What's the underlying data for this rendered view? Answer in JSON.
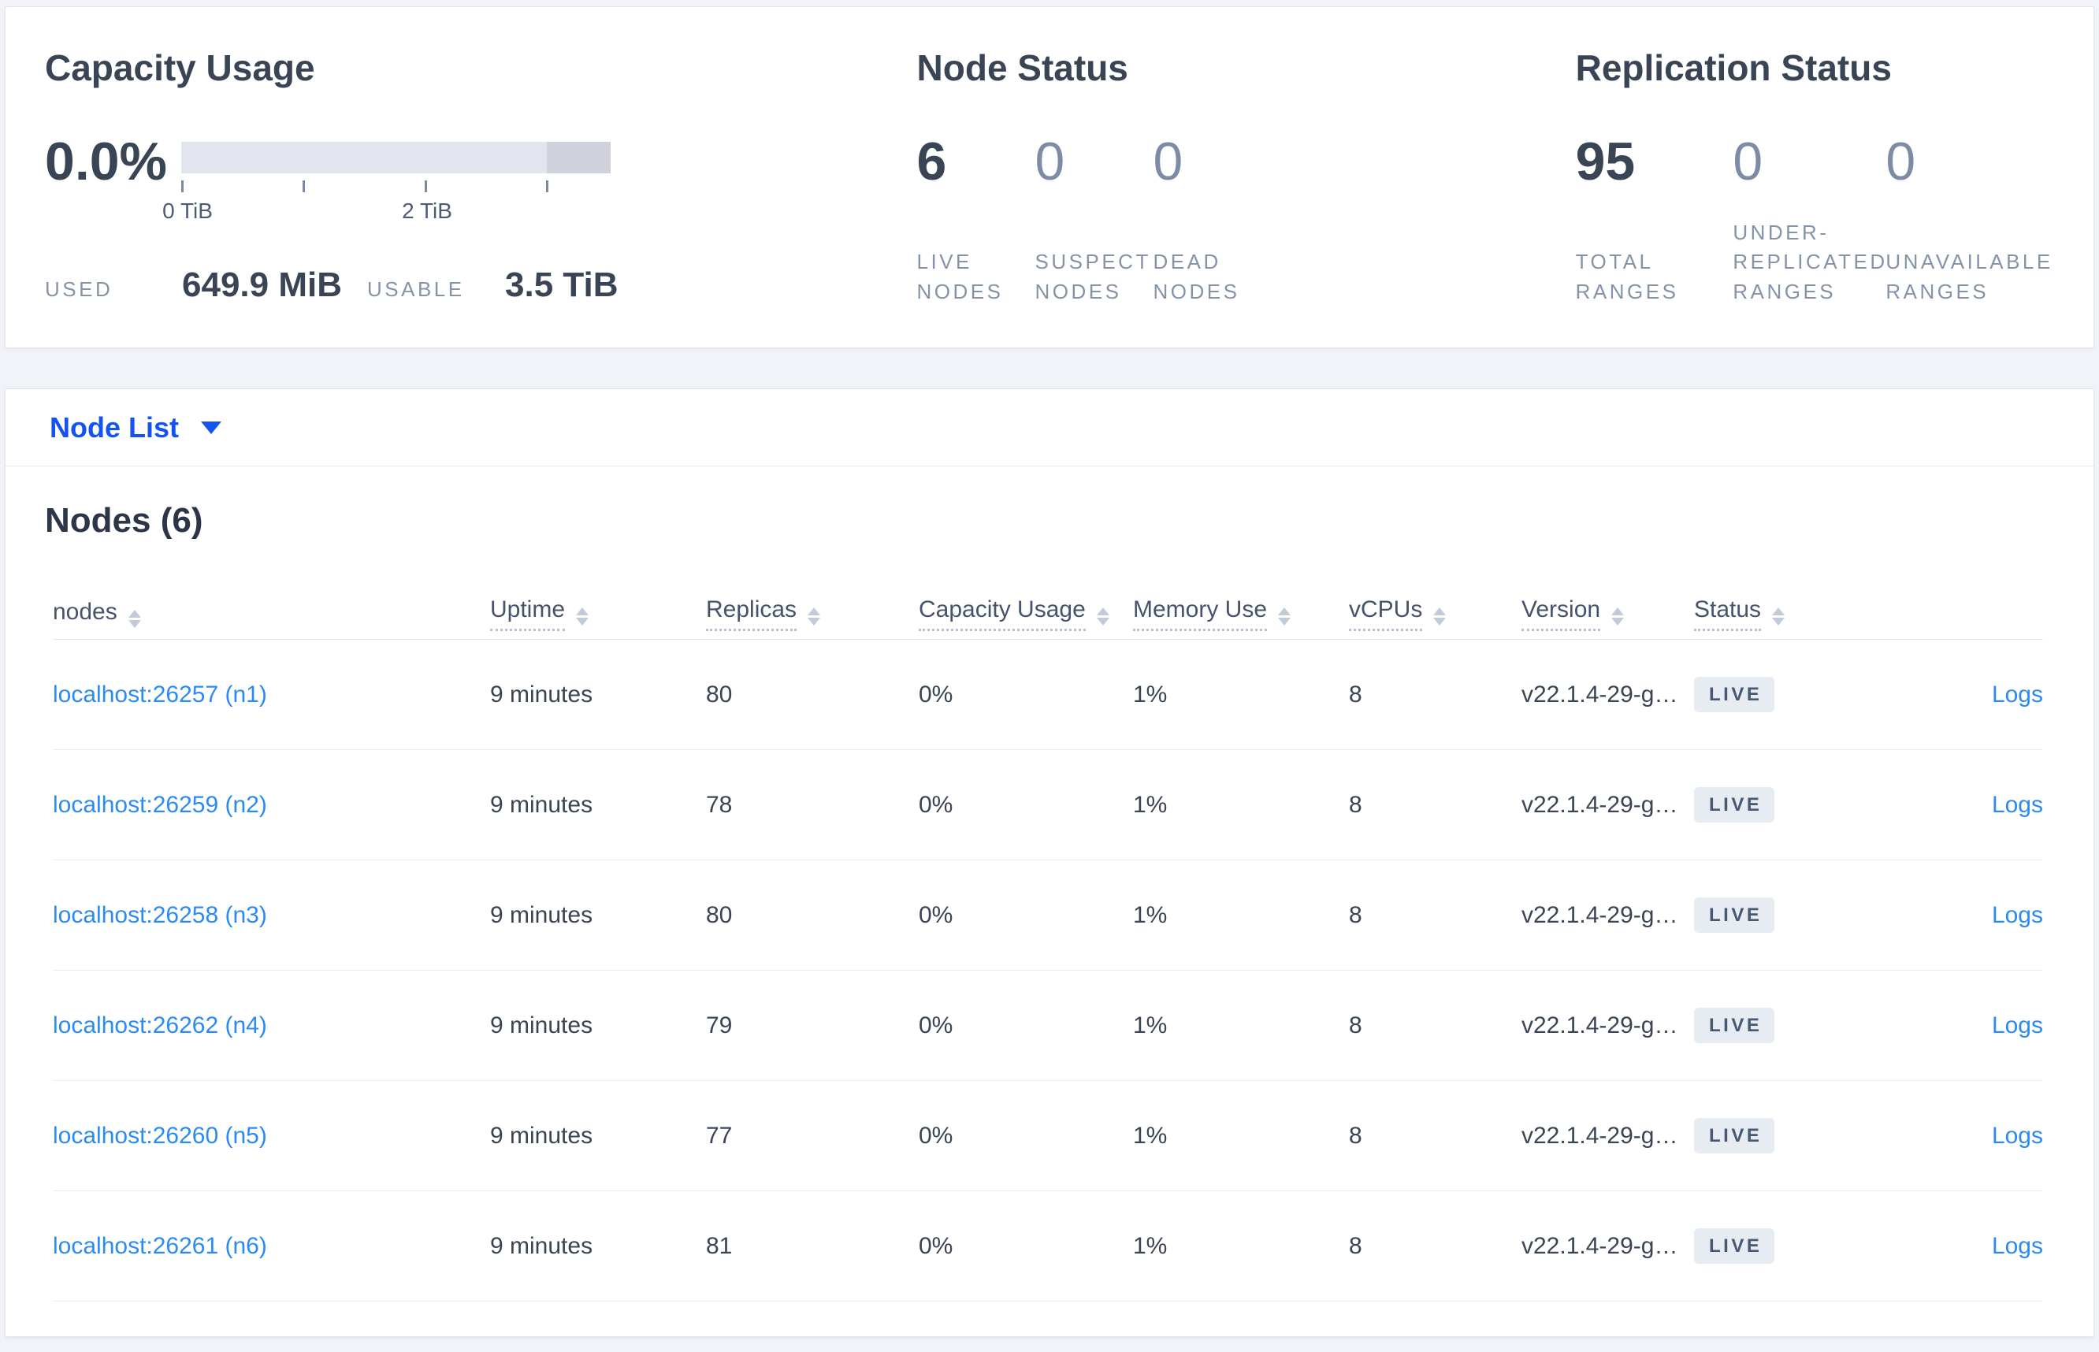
{
  "colors": {
    "page_bg": "#f1f3f8",
    "accent_blue": "#1553f1",
    "link_blue": "#2b8bf2",
    "heading": "#394455",
    "muted_label": "#8593a9",
    "bar_track": "#e2e5ee",
    "bar_segment": "#cfd2dd",
    "badge_bg": "#e7ebf2",
    "badge_text": "#475872"
  },
  "summary": {
    "capacity": {
      "title": "Capacity Usage",
      "percent": "0.0%",
      "gauge": {
        "tick_label_0": "0 TiB",
        "tick_label_2": "2 TiB",
        "axis_max": "3.5 TiB"
      },
      "used_label": "USED",
      "used_value": "649.9 MiB",
      "usable_label": "USABLE",
      "usable_value": "3.5 TiB"
    },
    "node_status": {
      "title": "Node Status",
      "stats": [
        {
          "value": "6",
          "label": "LIVE NODES"
        },
        {
          "value": "0",
          "label": "SUSPECT NODES"
        },
        {
          "value": "0",
          "label": "DEAD NODES"
        }
      ]
    },
    "replication": {
      "title": "Replication Status",
      "stats": [
        {
          "value": "95",
          "label": "TOTAL RANGES"
        },
        {
          "value": "0",
          "label": "UNDER-REPLICATED RANGES"
        },
        {
          "value": "0",
          "label": "UNAVAILABLE RANGES"
        }
      ]
    }
  },
  "view_selector": {
    "label": "Node List"
  },
  "table": {
    "title": "Nodes (6)",
    "columns": [
      {
        "label": "nodes"
      },
      {
        "label": "Uptime"
      },
      {
        "label": "Replicas"
      },
      {
        "label": "Capacity Usage"
      },
      {
        "label": "Memory Use"
      },
      {
        "label": "vCPUs"
      },
      {
        "label": "Version"
      },
      {
        "label": "Status"
      }
    ],
    "rows": [
      {
        "node": "localhost:26257 (n1)",
        "uptime": "9 minutes",
        "replicas": "80",
        "capacity": "0%",
        "memory": "1%",
        "vcpus": "8",
        "version": "v22.1.4-29-g…",
        "status": "LIVE",
        "logs": "Logs"
      },
      {
        "node": "localhost:26259 (n2)",
        "uptime": "9 minutes",
        "replicas": "78",
        "capacity": "0%",
        "memory": "1%",
        "vcpus": "8",
        "version": "v22.1.4-29-g…",
        "status": "LIVE",
        "logs": "Logs"
      },
      {
        "node": "localhost:26258 (n3)",
        "uptime": "9 minutes",
        "replicas": "80",
        "capacity": "0%",
        "memory": "1%",
        "vcpus": "8",
        "version": "v22.1.4-29-g…",
        "status": "LIVE",
        "logs": "Logs"
      },
      {
        "node": "localhost:26262 (n4)",
        "uptime": "9 minutes",
        "replicas": "79",
        "capacity": "0%",
        "memory": "1%",
        "vcpus": "8",
        "version": "v22.1.4-29-g…",
        "status": "LIVE",
        "logs": "Logs"
      },
      {
        "node": "localhost:26260 (n5)",
        "uptime": "9 minutes",
        "replicas": "77",
        "capacity": "0%",
        "memory": "1%",
        "vcpus": "8",
        "version": "v22.1.4-29-g…",
        "status": "LIVE",
        "logs": "Logs"
      },
      {
        "node": "localhost:26261 (n6)",
        "uptime": "9 minutes",
        "replicas": "81",
        "capacity": "0%",
        "memory": "1%",
        "vcpus": "8",
        "version": "v22.1.4-29-g…",
        "status": "LIVE",
        "logs": "Logs"
      }
    ]
  }
}
